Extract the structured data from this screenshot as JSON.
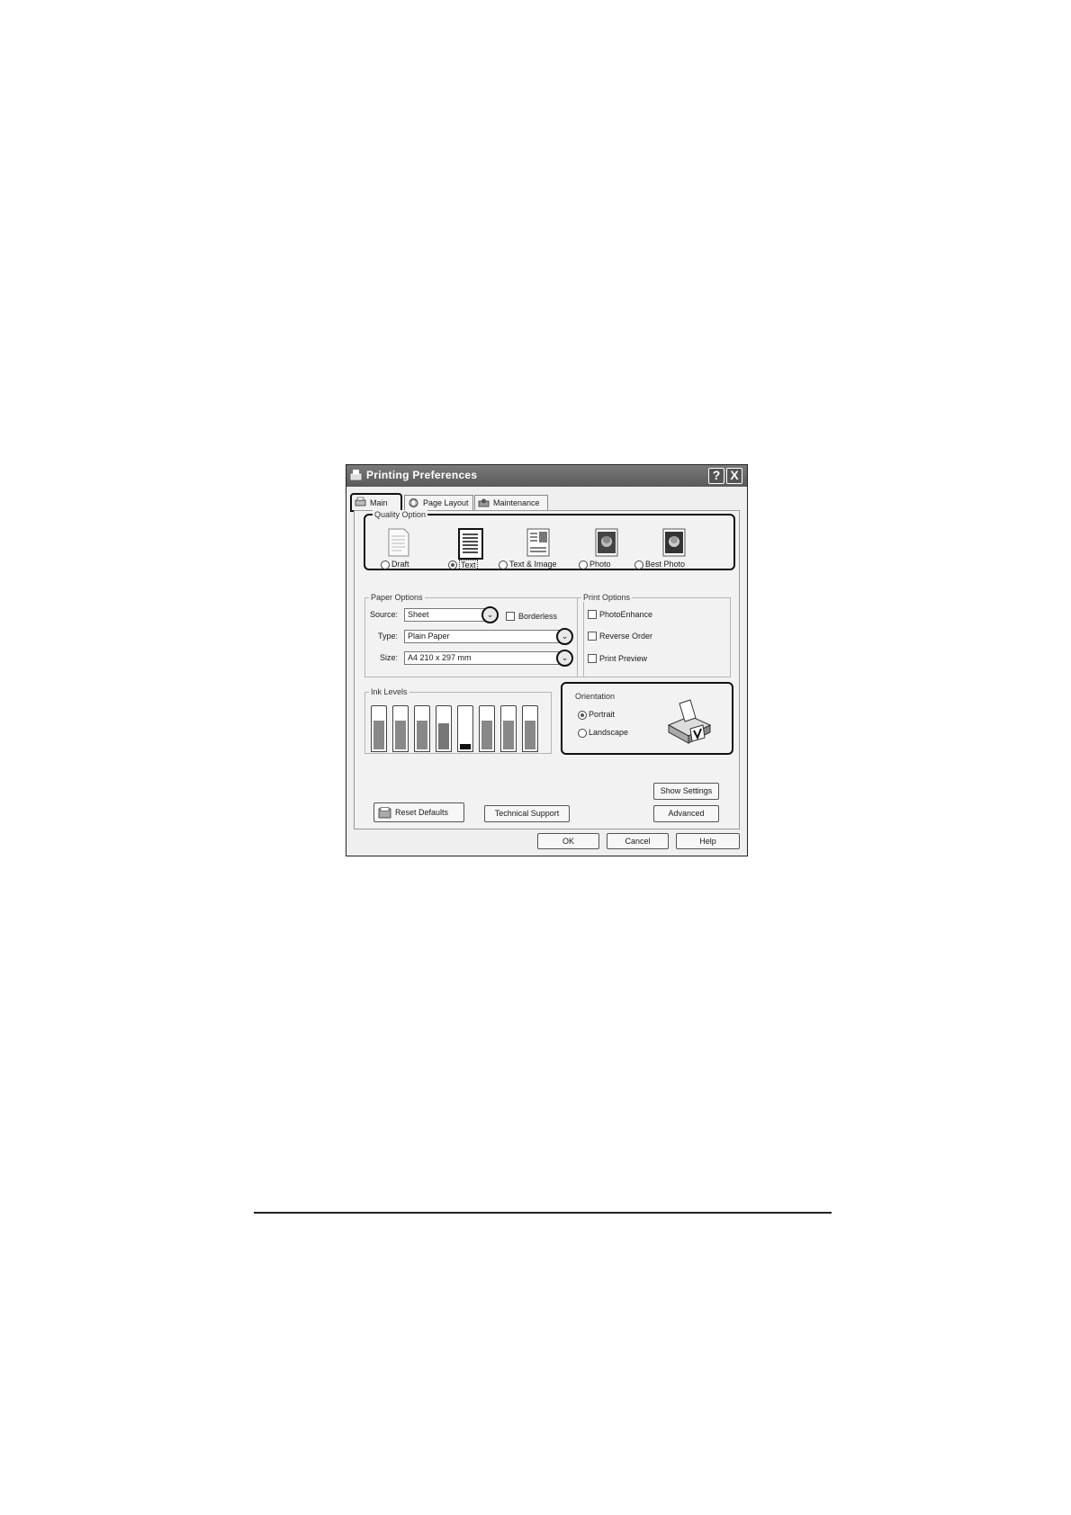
{
  "window": {
    "title": "Printing Preferences",
    "help_btn": "?",
    "close_btn": "X"
  },
  "tabs": [
    {
      "label": "Main"
    },
    {
      "label": "Page Layout"
    },
    {
      "label": "Maintenance"
    }
  ],
  "quality": {
    "group_label": "Quality Option",
    "selected": "Text",
    "options": [
      {
        "label": "Draft",
        "icon": "draft-page-icon"
      },
      {
        "label": "Text",
        "icon": "text-page-icon"
      },
      {
        "label": "Text & Image",
        "icon": "text-image-page-icon"
      },
      {
        "label": "Photo",
        "icon": "photo-icon"
      },
      {
        "label": "Best Photo",
        "icon": "best-photo-icon"
      }
    ]
  },
  "paper": {
    "group_label": "Paper Options",
    "source_label": "Source:",
    "source_value": "Sheet",
    "borderless_label": "Borderless",
    "type_label": "Type:",
    "type_value": "Plain Paper",
    "size_label": "Size:",
    "size_value": "A4 210 x 297 mm",
    "dropdown_glyph": "⌄"
  },
  "print_options": {
    "group_label": "Print Options",
    "items": [
      {
        "label": "PhotoEnhance"
      },
      {
        "label": "Reverse Order"
      },
      {
        "label": "Print Preview"
      }
    ]
  },
  "ink": {
    "group_label": "Ink Levels",
    "levels": [
      0.75,
      0.75,
      0.75,
      0.7,
      0.15,
      0.75,
      0.75,
      0.75
    ],
    "fill_colors": [
      "#888888",
      "#888888",
      "#888888",
      "#777777",
      "#111111",
      "#888888",
      "#888888",
      "#888888"
    ]
  },
  "orientation": {
    "group_label": "Orientation",
    "selected": "Portrait",
    "portrait_label": "Portrait",
    "landscape_label": "Landscape"
  },
  "buttons": {
    "show_settings": "Show Settings",
    "advanced": "Advanced",
    "reset_defaults": "Reset Defaults",
    "technical_support": "Technical Support",
    "ok": "OK",
    "cancel": "Cancel",
    "help": "Help"
  }
}
